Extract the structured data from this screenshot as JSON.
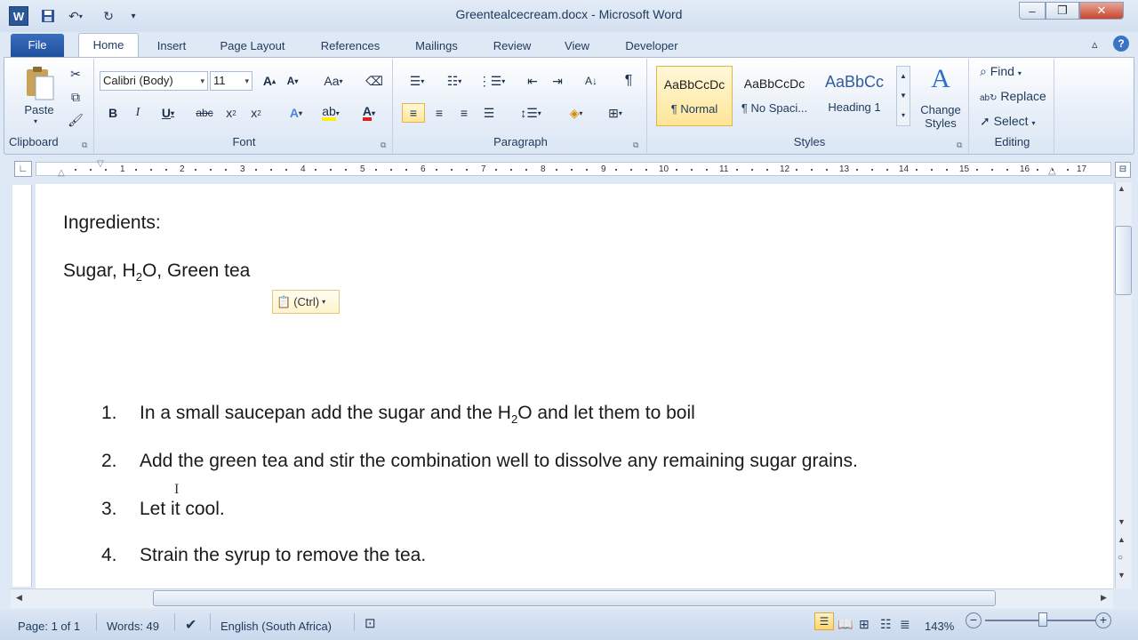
{
  "window": {
    "title": "Greentealcecream.docx - Microsoft Word",
    "app_icon": "W"
  },
  "tabs": [
    "File",
    "Home",
    "Insert",
    "Page Layout",
    "References",
    "Mailings",
    "Review",
    "View",
    "Developer"
  ],
  "ribbon": {
    "clipboard": {
      "label": "Clipboard",
      "paste": "Paste"
    },
    "font": {
      "label": "Font",
      "font_name": "Calibri (Body)",
      "font_size": "11"
    },
    "paragraph": {
      "label": "Paragraph"
    },
    "styles": {
      "label": "Styles",
      "items": [
        {
          "preview": "AaBbCcDc",
          "name": "¶ Normal"
        },
        {
          "preview": "AaBbCcDc",
          "name": "¶ No Spaci..."
        },
        {
          "preview": "AaBbCc",
          "name": "Heading 1"
        }
      ],
      "change_styles": "Change Styles"
    },
    "editing": {
      "label": "Editing",
      "find": "Find",
      "replace": "Replace",
      "select": "Select"
    }
  },
  "ruler": {
    "ticks": [
      "1",
      "2",
      "3",
      "4",
      "5",
      "6",
      "7",
      "8",
      "9",
      "10",
      "11",
      "12",
      "13",
      "14",
      "15",
      "16",
      "17"
    ]
  },
  "document": {
    "heading": "Ingredients:",
    "ingredients_pre": "Sugar, H",
    "ingredients_sub": "2",
    "ingredients_post": "O, Green tea",
    "paste_options": "(Ctrl)",
    "steps": [
      {
        "num": "1.",
        "pre": "In a small saucepan add the sugar and the H",
        "sub": "2",
        "post": "O and let them to boil"
      },
      {
        "num": "2.",
        "text": "Add the green tea and stir the combination well to dissolve any remaining sugar grains."
      },
      {
        "num": "3.",
        "text": "Let it cool."
      },
      {
        "num": "4.",
        "text": "Strain the syrup to remove the tea."
      }
    ]
  },
  "status": {
    "page": "Page: 1 of 1",
    "words": "Words: 49",
    "language": "English (South Africa)",
    "zoom": "143%"
  }
}
